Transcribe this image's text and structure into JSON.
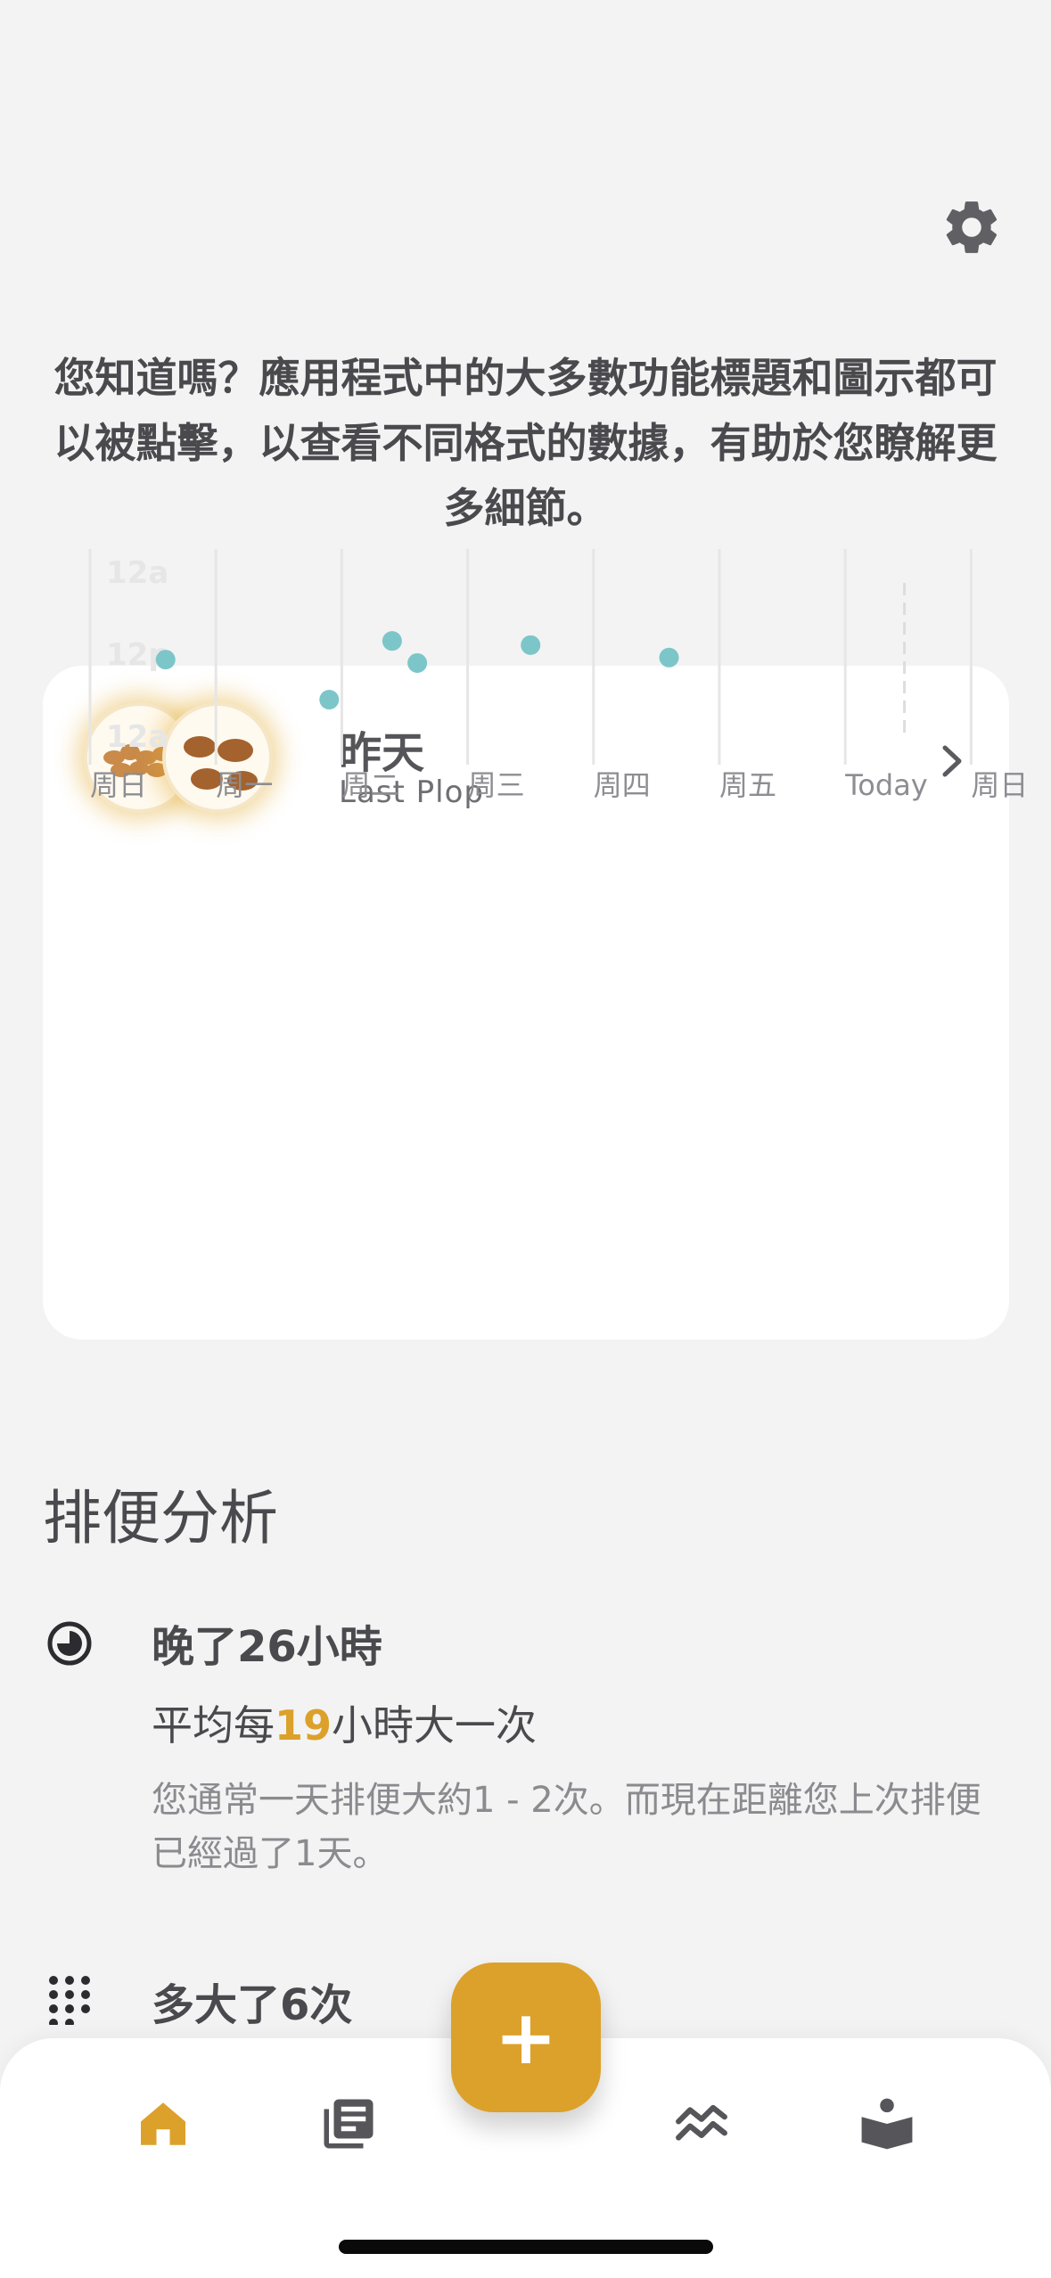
{
  "tip": "您知道嗎？應用程式中的大多數功能標題和圖示都可以被點擊，以查看不同格式的數據，有助於您瞭解更多細節。",
  "last_plop": {
    "title": "昨天",
    "subtitle": "Last Plop"
  },
  "chart_data": {
    "type": "scatter",
    "categories": [
      "周日",
      "周一",
      "周二",
      "周三",
      "周四",
      "周五",
      "Today",
      "周日"
    ],
    "y_ticks": [
      "12a",
      "12p",
      "12a"
    ],
    "points": [
      {
        "day": 0.6,
        "hour": 12.4
      },
      {
        "day": 1.9,
        "hour": 18.2
      },
      {
        "day": 2.4,
        "hour": 9.7
      },
      {
        "day": 2.6,
        "hour": 12.9
      },
      {
        "day": 3.5,
        "hour": 10.3
      },
      {
        "day": 4.6,
        "hour": 12.1
      }
    ],
    "point_color": "#7cc6c9",
    "today_marker": "dashed"
  },
  "analysis": {
    "title": "排便分析",
    "late": {
      "title": "晚了26小時",
      "avg_prefix": "平均每",
      "avg_value": "19",
      "avg_suffix": "小時大一次",
      "desc": "您通常一天排便大約1 - 2次。而現在距離您上次排便已經過了1天。"
    },
    "count": {
      "title": "多大了6次"
    }
  },
  "fab": {
    "label": "+"
  },
  "colors": {
    "accent": "#dca12a",
    "background": "#f3f3f3",
    "tab_inactive": "#55555a"
  },
  "icons": [
    "gear-icon",
    "chevron-right-icon",
    "clock-icon",
    "grid-dots-icon",
    "home-icon",
    "journal-icon",
    "trends-icon",
    "book-icon"
  ]
}
